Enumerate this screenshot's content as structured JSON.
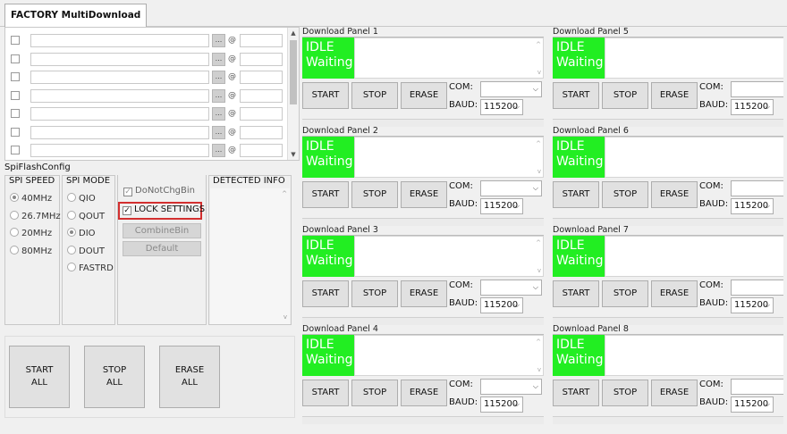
{
  "tab": {
    "label": "FACTORY MultiDownload"
  },
  "file_rows": 7,
  "spi": {
    "group_title": "SpiFlashConfig",
    "speed_header": "SPI SPEED",
    "speeds": [
      "40MHz",
      "26.7MHz",
      "20MHz",
      "80MHz"
    ],
    "speed_selected": "40MHz",
    "mode_header": "SPI MODE",
    "modes": [
      "QIO",
      "QOUT",
      "DIO",
      "DOUT",
      "FASTRD"
    ],
    "mode_selected": "DIO",
    "do_not_chg_bin": "DoNotChgBin",
    "lock_settings": "LOCK SETTINGS",
    "combine_bin": "CombineBin",
    "default": "Default",
    "detected_info": "DETECTED INFO"
  },
  "all_buttons": {
    "start": "START\nALL",
    "stop": "STOP\nALL",
    "erase": "ERASE\nALL"
  },
  "panels": [
    {
      "title": "Download Panel 1",
      "state": "IDLE",
      "status": "Waiting",
      "start": "START",
      "stop": "STOP",
      "erase": "ERASE",
      "com_label": "COM:",
      "com_value": "",
      "baud_label": "BAUD:",
      "baud_value": "115200"
    },
    {
      "title": "Download Panel 2",
      "state": "IDLE",
      "status": "Waiting",
      "start": "START",
      "stop": "STOP",
      "erase": "ERASE",
      "com_label": "COM:",
      "com_value": "",
      "baud_label": "BAUD:",
      "baud_value": "115200"
    },
    {
      "title": "Download Panel 3",
      "state": "IDLE",
      "status": "Waiting",
      "start": "START",
      "stop": "STOP",
      "erase": "ERASE",
      "com_label": "COM:",
      "com_value": "",
      "baud_label": "BAUD:",
      "baud_value": "115200"
    },
    {
      "title": "Download Panel 4",
      "state": "IDLE",
      "status": "Waiting",
      "start": "START",
      "stop": "STOP",
      "erase": "ERASE",
      "com_label": "COM:",
      "com_value": "",
      "baud_label": "BAUD:",
      "baud_value": "115200"
    },
    {
      "title": "Download Panel 5",
      "state": "IDLE",
      "status": "Waiting",
      "start": "START",
      "stop": "STOP",
      "erase": "ERASE",
      "com_label": "COM:",
      "com_value": "",
      "baud_label": "BAUD:",
      "baud_value": "115200"
    },
    {
      "title": "Download Panel 6",
      "state": "IDLE",
      "status": "Waiting",
      "start": "START",
      "stop": "STOP",
      "erase": "ERASE",
      "com_label": "COM:",
      "com_value": "",
      "baud_label": "BAUD:",
      "baud_value": "115200"
    },
    {
      "title": "Download Panel 7",
      "state": "IDLE",
      "status": "Waiting",
      "start": "START",
      "stop": "STOP",
      "erase": "ERASE",
      "com_label": "COM:",
      "com_value": "",
      "baud_label": "BAUD:",
      "baud_value": "115200"
    },
    {
      "title": "Download Panel 8",
      "state": "IDLE",
      "status": "Waiting",
      "start": "START",
      "stop": "STOP",
      "erase": "ERASE",
      "com_label": "COM:",
      "com_value": "",
      "baud_label": "BAUD:",
      "baud_value": "115200"
    }
  ],
  "colors": {
    "status_idle": "#22ee22",
    "highlight": "#d32f2f"
  }
}
